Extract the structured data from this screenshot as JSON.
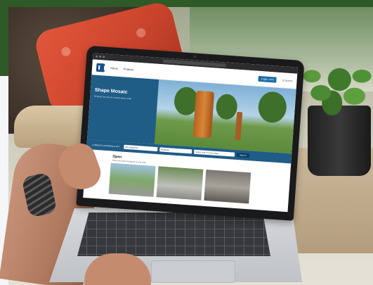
{
  "browser": {
    "url": ""
  },
  "site": {
    "nav": {
      "home": "Home",
      "projects": "Projects"
    },
    "login_label": "Login / Join",
    "search_link": "Q Search"
  },
  "hero": {
    "title": "Shape Mosaic",
    "subtitle": "Bringing the best of a better place to life"
  },
  "search_band": {
    "label": "Looking for something to do?",
    "category": "All categories",
    "suburb": "Anybody",
    "date": "Select one or more dates",
    "go": "Search"
  },
  "open": {
    "title": "Open",
    "subtitle": "Have your say on projects in your area"
  }
}
